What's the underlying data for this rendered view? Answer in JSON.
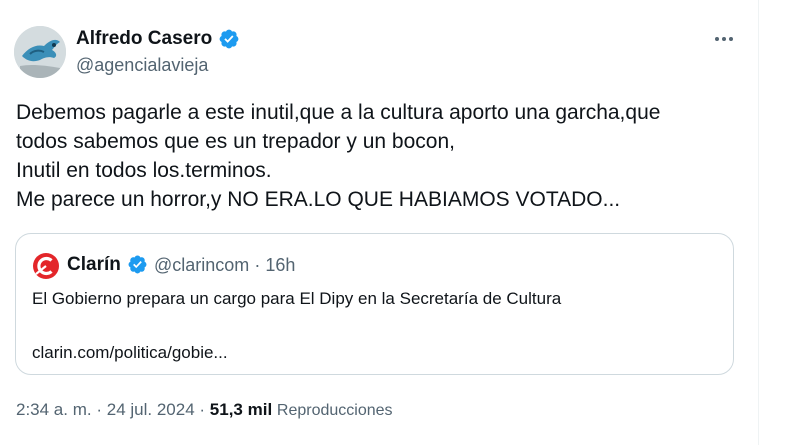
{
  "author": {
    "name": "Alfredo Casero",
    "handle": "@agencialavieja",
    "verified": true
  },
  "tweet": {
    "lines": [
      "Debemos pagarle a este inutil,que a la cultura aporto una garcha,que",
      "todos sabemos que es un trepador y un bocon,",
      "Inutil en todos los.terminos.",
      "Me parece un horror,y NO ERA.LO QUE HABIAMOS VOTADO..."
    ]
  },
  "quote": {
    "name": "Clarín",
    "handle": "@clarincom",
    "separator": "·",
    "time": "16h",
    "text": "El Gobierno prepara un cargo para El Dipy en la Secretaría de Cultura",
    "link": "clarin.com/politica/gobie..."
  },
  "footer": {
    "time": "2:34 a. m.",
    "date": "24 jul. 2024",
    "separator": "·",
    "views_count": "51,3 mil",
    "views_label": "Reproducciones"
  },
  "colors": {
    "verified_blue": "#1d9bf0",
    "clarin_red": "#e3262a",
    "muted_text": "#536471",
    "border": "#cfd9de"
  },
  "icons": {
    "verified": "verified-badge-icon",
    "more": "more-options-icon",
    "clarin_logo": "clarin-logo-icon"
  }
}
